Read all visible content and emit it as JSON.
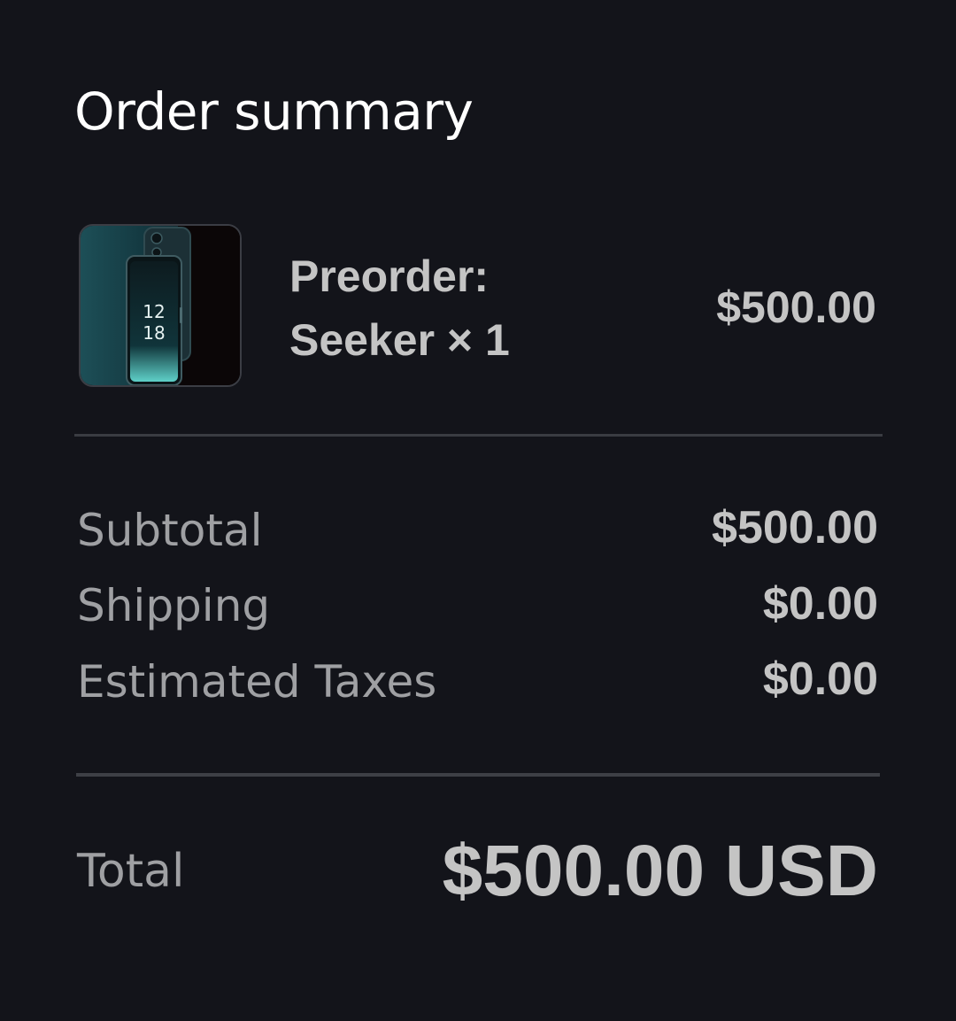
{
  "header": {
    "title": "Order summary"
  },
  "line_item": {
    "image_icon": "product-phone-image",
    "name_line1": "Preorder:",
    "name_line2": "Seeker × 1",
    "price": "$500.00",
    "thumb_time_hour": "12",
    "thumb_time_minute": "18"
  },
  "breakdown": [
    {
      "label": "Subtotal",
      "value": "$500.00"
    },
    {
      "label": "Shipping",
      "value": "$0.00"
    },
    {
      "label": "Estimated Taxes",
      "value": "$0.00"
    }
  ],
  "total": {
    "label": "Total",
    "value": "$500.00 USD"
  },
  "colors": {
    "background": "#13141a",
    "title": "#ffffff",
    "value_text": "#c4c4c4",
    "label_text": "#9fa0a3",
    "divider": "#3a3c42"
  }
}
